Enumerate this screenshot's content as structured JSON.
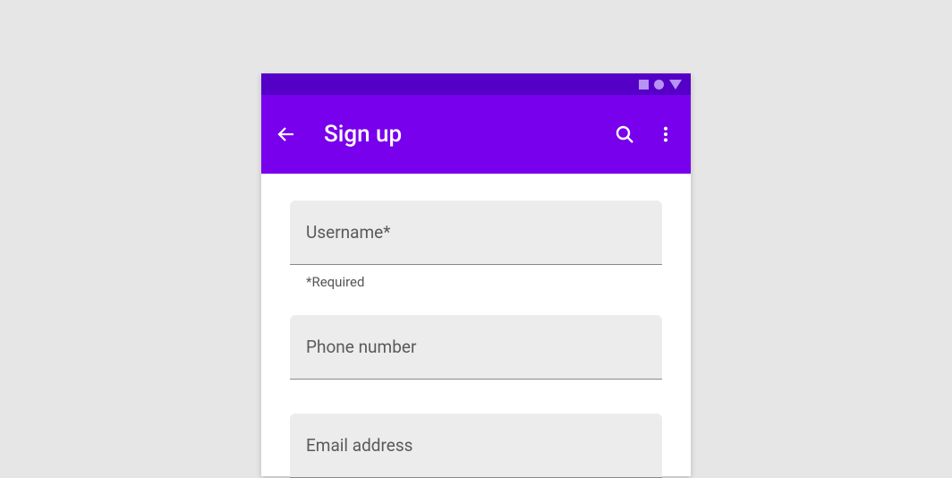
{
  "appbar": {
    "title": "Sign up"
  },
  "fields": {
    "username": {
      "label": "Username*",
      "helper": "*Required"
    },
    "phone": {
      "label": "Phone number"
    },
    "email": {
      "label": "Email address"
    }
  }
}
